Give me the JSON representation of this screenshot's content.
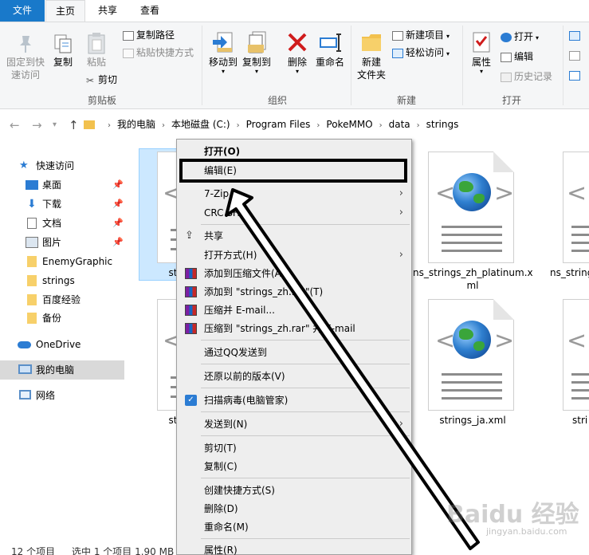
{
  "tabs": {
    "file": "文件",
    "home": "主页",
    "share": "共享",
    "view": "查看"
  },
  "ribbon": {
    "clipboard": {
      "pin_quick": "固定到快速访问",
      "pin_quick_l1": "固定到快",
      "pin_quick_l2": "速访问",
      "copy": "复制",
      "paste": "粘贴",
      "copy_path": "复制路径",
      "paste_shortcut": "粘贴快捷方式",
      "cut": "剪切",
      "label": "剪贴板"
    },
    "organize": {
      "move_to": "移动到",
      "copy_to": "复制到",
      "delete": "删除",
      "rename": "重命名",
      "label": "组织"
    },
    "new": {
      "new_folder_l1": "新建",
      "new_folder_l2": "文件夹",
      "new_item": "新建项目",
      "easy_access": "轻松访问",
      "label": "新建"
    },
    "open": {
      "properties": "属性",
      "open": "打开",
      "edit": "编辑",
      "history": "历史记录",
      "label": "打开"
    }
  },
  "address": {
    "crumbs": [
      "我的电脑",
      "本地磁盘 (C:)",
      "Program Files",
      "PokeMMO",
      "data",
      "strings"
    ]
  },
  "nav": {
    "quick_access": "快速访问",
    "items": [
      {
        "label": "桌面",
        "pinned": true
      },
      {
        "label": "下载",
        "pinned": true
      },
      {
        "label": "文档",
        "pinned": true
      },
      {
        "label": "图片",
        "pinned": true
      },
      {
        "label": "EnemyGraphic",
        "pinned": false
      },
      {
        "label": "strings",
        "pinned": false
      },
      {
        "label": "百度经验",
        "pinned": false
      },
      {
        "label": "备份",
        "pinned": false
      }
    ],
    "onedrive": "OneDrive",
    "this_pc": "我的电脑",
    "network": "网络"
  },
  "files": {
    "f1": "st",
    "f2": "ns_strings_zh_platinum.x",
    "f2b": "ml",
    "f3": "ns_string",
    "f4": "st",
    "f5": "strings_ja.xml",
    "f6": "stri"
  },
  "status": {
    "count": "12 个项目",
    "selected": "选中 1 个项目 1.90 MB"
  },
  "context_menu": {
    "open": "打开(O)",
    "edit": "编辑(E)",
    "sevenzip": "7-Zip",
    "crcsha": "CRC SHA",
    "share": "共享",
    "open_with": "打开方式(H)",
    "add_archive": "添加到压缩文件(A)...",
    "add_rar": "添加到 \"strings_zh.rar\"(T)",
    "compress_email": "压缩并 E-mail...",
    "compress_rar_email": "压缩到 \"strings_zh.rar\" 并 E-mail",
    "send_qq": "通过QQ发送到",
    "restore": "还原以前的版本(V)",
    "scan": "扫描病毒(电脑管家)",
    "send_to": "发送到(N)",
    "cut": "剪切(T)",
    "copy": "复制(C)",
    "create_shortcut": "创建快捷方式(S)",
    "delete": "删除(D)",
    "rename": "重命名(M)",
    "properties": "属性(R)"
  },
  "watermark": {
    "brand": "Baidu 经验",
    "url": "jingyan.baidu.com"
  },
  "colors": {
    "file_tab": "#1979ca",
    "menu_bg": "#eeeeee",
    "accent": "#0078d7"
  }
}
